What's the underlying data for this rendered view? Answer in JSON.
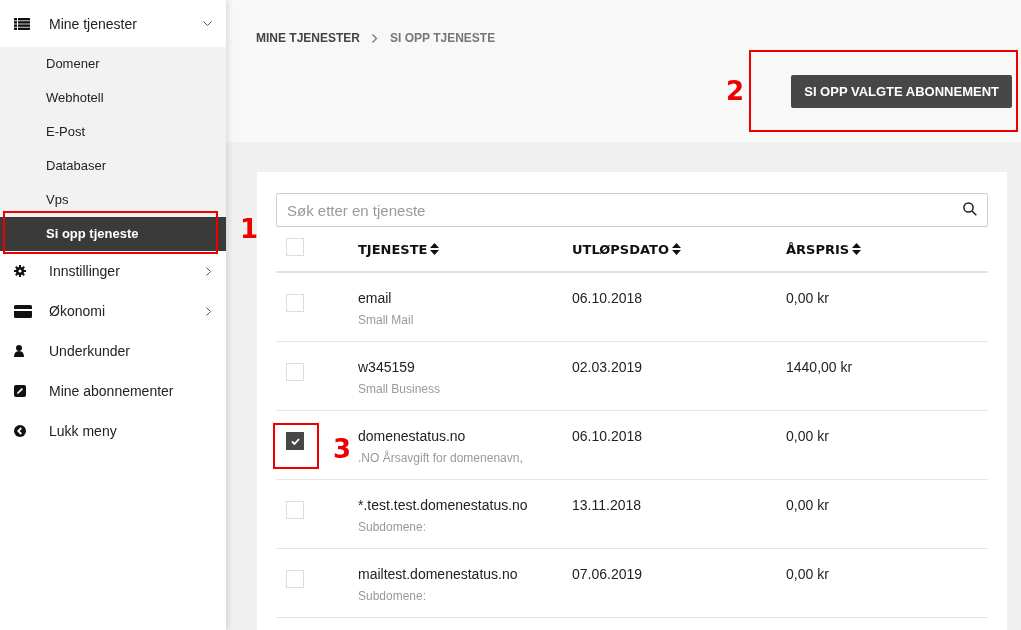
{
  "sidebar": {
    "items": [
      {
        "kind": "list",
        "label": "Mine tjenester",
        "expanded": true,
        "children": [
          {
            "label": "Domener",
            "selected": false
          },
          {
            "label": "Webhotell",
            "selected": false
          },
          {
            "label": "E-Post",
            "selected": false
          },
          {
            "label": "Databaser",
            "selected": false
          },
          {
            "label": "Vps",
            "selected": false
          },
          {
            "label": "Si opp tjeneste",
            "selected": true
          }
        ]
      },
      {
        "kind": "gear",
        "label": "Innstillinger",
        "expanded": false
      },
      {
        "kind": "card",
        "label": "Økonomi",
        "expanded": false
      },
      {
        "kind": "user",
        "label": "Underkunder"
      },
      {
        "kind": "edit",
        "label": "Mine abonnementer"
      },
      {
        "kind": "back",
        "label": "Lukk meny"
      }
    ]
  },
  "breadcrumb": [
    "MINE TJENESTER",
    "SI OPP TJENESTE"
  ],
  "cancel_button": "SI OPP VALGTE ABONNEMENT",
  "search": {
    "placeholder": "Søk etter en tjeneste"
  },
  "table": {
    "select_all": {
      "checked": false
    },
    "columns": [
      "TJENESTE",
      "UTLØPSDATO",
      "ÅRSPRIS"
    ],
    "rows": [
      {
        "name": "email",
        "description": "Small Mail",
        "expiry": "06.10.2018",
        "price": "0,00 kr",
        "selected": false
      },
      {
        "name": "w345159",
        "description": "Small Business",
        "expiry": "02.03.2019",
        "price": "1440,00 kr",
        "selected": false
      },
      {
        "name": "domenestatus.no",
        "description": ".NO Årsavgift for domenenavn,",
        "expiry": "06.10.2018",
        "price": "0,00 kr",
        "selected": true
      },
      {
        "name": "*.test.test.domenestatus.no",
        "description": "Subdomene:",
        "expiry": "13.11.2018",
        "price": "0,00 kr",
        "selected": false
      },
      {
        "name": "mailtest.domenestatus.no",
        "description": "Subdomene:",
        "expiry": "07.06.2019",
        "price": "0,00 kr",
        "selected": false
      }
    ]
  },
  "callouts": [
    {
      "label": "1"
    },
    {
      "label": "2"
    },
    {
      "label": "3"
    }
  ]
}
